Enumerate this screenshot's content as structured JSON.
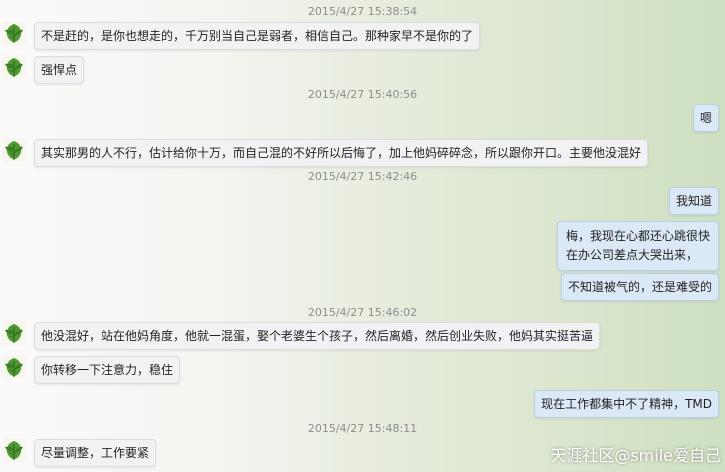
{
  "timestamps": [
    "2015/4/27 15:38:54",
    "2015/4/27 15:40:56",
    "2015/4/27 15:42:46",
    "2015/4/27 15:46:02",
    "2015/4/27 15:48:11"
  ],
  "messages": {
    "m1": "不是赶的，是你也想走的，千万别当自己是弱者，相信自己。那种家早不是你的了",
    "m2": "强悍点",
    "m3": "嗯",
    "m4": "其实那男的人不行，估计给你十万，而自己混的不好所以后悔了，加上他妈碎碎念，所以跟你开口。主要他没混好",
    "m5": "我知道",
    "m6_line1": "梅，我现在心都还心跳很快",
    "m6_line2": "在办公司差点大哭出来，",
    "m7": "不知道被气的，还是难受的",
    "m8": "他没混好，站在他妈角度，他就一混蛋，娶个老婆生个孩子，然后离婚，然后创业失败，他妈其实挺苦逼",
    "m9": "你转移一下注意力，稳住",
    "m10": "现在工作都集中不了精神，TMD",
    "m11": "尽量调整，工作要紧"
  },
  "watermark": "天涯社区@smile爱自己",
  "colors": {
    "incoming_bubble": "#f2f2f4",
    "outgoing_bubble": "#dbe9f7",
    "timestamp": "#8d8d8d",
    "avatar_leaf": "#3f8a2e"
  }
}
